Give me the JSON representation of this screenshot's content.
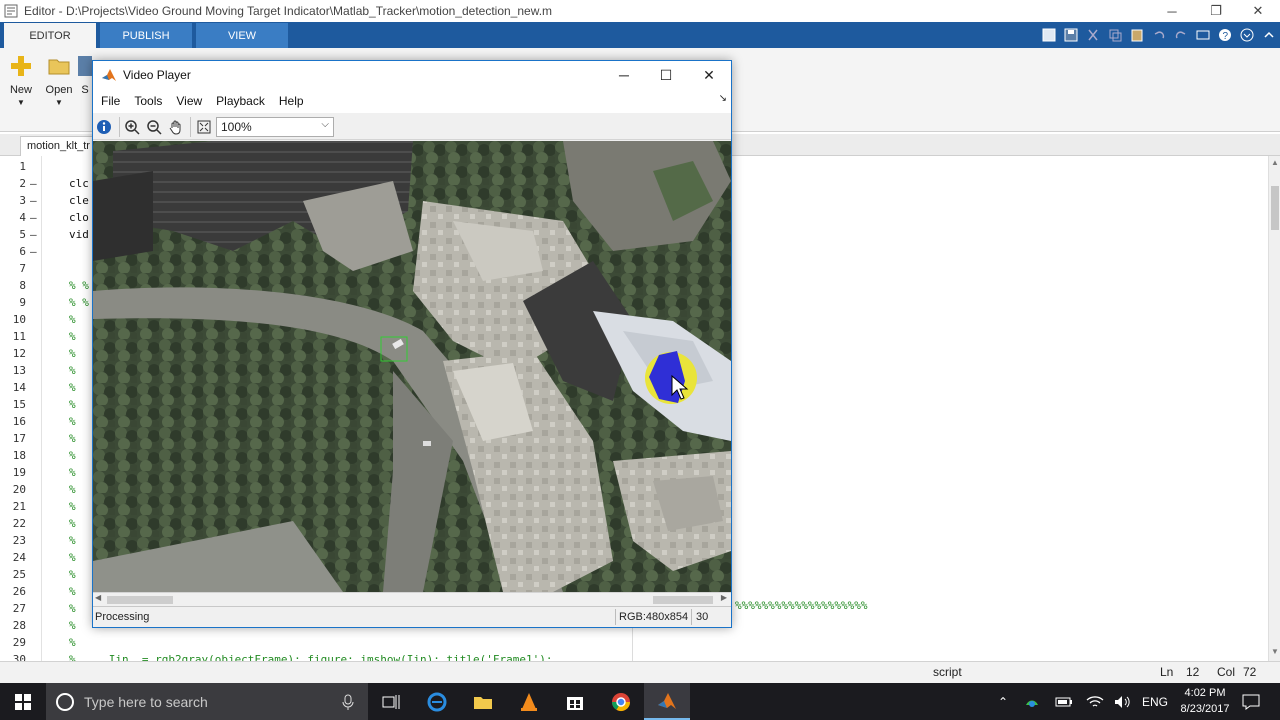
{
  "editor_window": {
    "title": "Editor - D:\\Projects\\Video Ground Moving Target Indicator\\Matlab_Tracker\\motion_detection_new.m"
  },
  "ribbon": {
    "tabs": [
      "EDITOR",
      "PUBLISH",
      "VIEW"
    ],
    "buttons": {
      "new": "New",
      "open": "Open",
      "save_partial": "S"
    }
  },
  "file_tabs": [
    "motion_klt_tr"
  ],
  "code_lines": [
    {
      "n": "1",
      "mark": "",
      "code": "",
      "type": "code"
    },
    {
      "n": "2",
      "mark": "–",
      "code": "clc",
      "type": "code"
    },
    {
      "n": "3",
      "mark": "–",
      "code": "cle",
      "type": "code"
    },
    {
      "n": "4",
      "mark": "–",
      "code": "clo",
      "type": "code"
    },
    {
      "n": "5",
      "mark": "–",
      "code": "vid",
      "type": "code"
    },
    {
      "n": "6",
      "mark": "–",
      "code": "",
      "type": "code"
    },
    {
      "n": "7",
      "mark": "",
      "code": "",
      "type": "code"
    },
    {
      "n": "8",
      "mark": "",
      "code": "% %",
      "type": "comment"
    },
    {
      "n": "9",
      "mark": "",
      "code": "% %",
      "type": "comment"
    },
    {
      "n": "10",
      "mark": "",
      "code": "%",
      "type": "comment"
    },
    {
      "n": "11",
      "mark": "",
      "code": "%",
      "type": "comment"
    },
    {
      "n": "12",
      "mark": "",
      "code": "%",
      "type": "comment"
    },
    {
      "n": "13",
      "mark": "",
      "code": "%",
      "type": "comment"
    },
    {
      "n": "14",
      "mark": "",
      "code": "%",
      "type": "comment"
    },
    {
      "n": "15",
      "mark": "",
      "code": "%",
      "type": "comment"
    },
    {
      "n": "16",
      "mark": "",
      "code": "%",
      "type": "comment"
    },
    {
      "n": "17",
      "mark": "",
      "code": "%",
      "type": "comment"
    },
    {
      "n": "18",
      "mark": "",
      "code": "%",
      "type": "comment"
    },
    {
      "n": "19",
      "mark": "",
      "code": "%",
      "type": "comment"
    },
    {
      "n": "20",
      "mark": "",
      "code": "%",
      "type": "comment"
    },
    {
      "n": "21",
      "mark": "",
      "code": "%",
      "type": "comment"
    },
    {
      "n": "22",
      "mark": "",
      "code": "%",
      "type": "comment"
    },
    {
      "n": "23",
      "mark": "",
      "code": "%",
      "type": "comment"
    },
    {
      "n": "24",
      "mark": "",
      "code": "%",
      "type": "comment"
    },
    {
      "n": "25",
      "mark": "",
      "code": "%",
      "type": "comment"
    },
    {
      "n": "26",
      "mark": "",
      "code": "%",
      "type": "comment"
    },
    {
      "n": "27",
      "mark": "",
      "code": "%",
      "type": "comment"
    },
    {
      "n": "28",
      "mark": "",
      "code": "%",
      "type": "comment"
    },
    {
      "n": "29",
      "mark": "",
      "code": "%",
      "type": "comment"
    },
    {
      "n": "30",
      "mark": "",
      "code": "%     Iin  = rgb2gray(objectFrame); figure; imshow(Iin); title('Frame1');",
      "type": "comment"
    }
  ],
  "hidden_comment_tail": "%%%%%%%%%%%%%%%%%%%%",
  "statusbar": {
    "mode": "script",
    "ln_label": "Ln",
    "ln": "12",
    "col_label": "Col",
    "col": "72"
  },
  "video_player": {
    "title": "Video Player",
    "menu": [
      "File",
      "Tools",
      "View",
      "Playback",
      "Help"
    ],
    "zoom": "100%",
    "status": "Processing",
    "rgb_info": "RGB:480x854",
    "frame_number": "30"
  },
  "taskbar": {
    "search_placeholder": "Type here to search",
    "language": "ENG",
    "time": "4:02 PM",
    "date": "8/23/2017"
  },
  "colors": {
    "ribbon_blue": "#1e5a9e",
    "comment_green": "#228b22",
    "tracked_target_yellow": "#e9e43a",
    "tracked_target_blue": "#2f2fd6",
    "detection_box_green": "#33cc33"
  }
}
